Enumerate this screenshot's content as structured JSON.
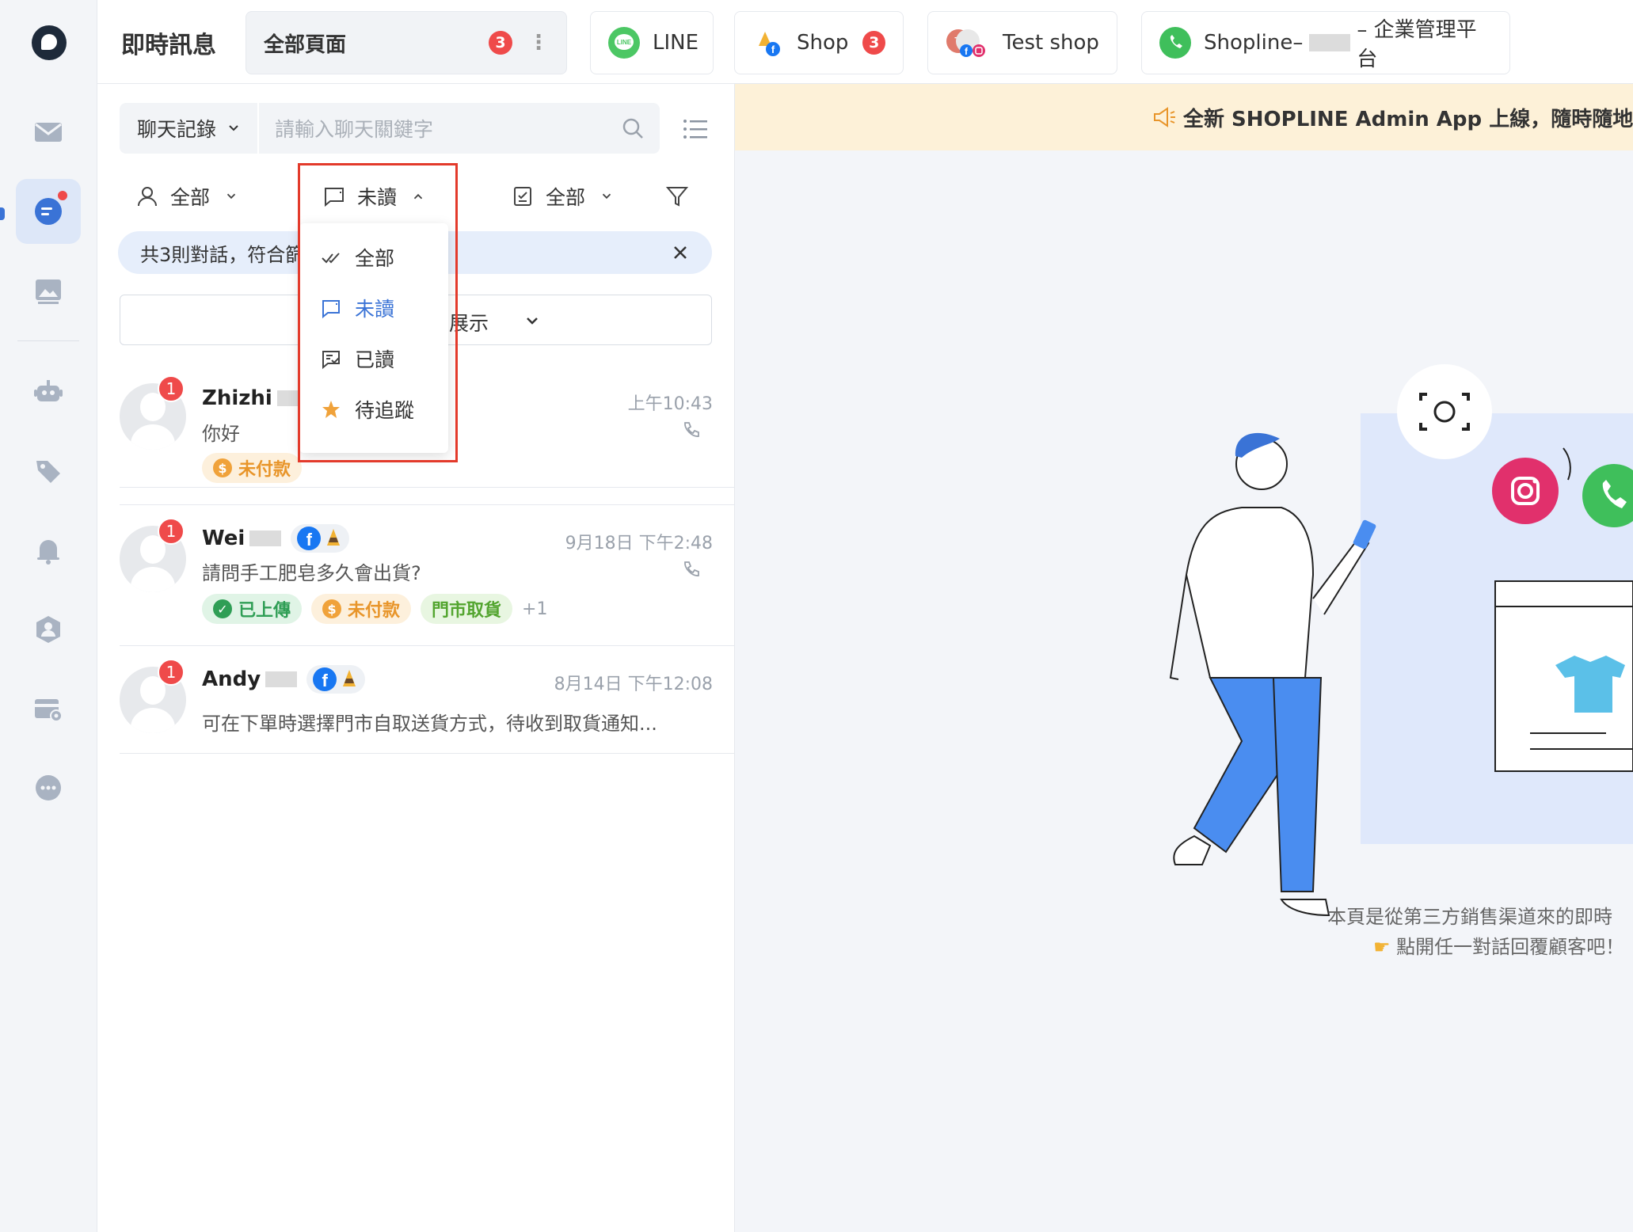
{
  "header": {
    "app_title": "即時訊息",
    "tabs": [
      {
        "label": "全部頁面",
        "badge": "3"
      },
      {
        "label": "LINE"
      },
      {
        "label": "Shop",
        "badge": "3"
      },
      {
        "label": "Test shop"
      },
      {
        "label_prefix": "Shopline–",
        "label_suffix": "– 企業管理平台"
      }
    ]
  },
  "search": {
    "scope": "聊天記錄",
    "placeholder": "請輸入聊天關鍵字"
  },
  "filters": {
    "assignee": "全部",
    "read_state": "未讀",
    "task": "全部"
  },
  "summary": {
    "text": "共3則對話，符合篩"
  },
  "display_box": {
    "text": "展示"
  },
  "read_dropdown": {
    "options": [
      "全部",
      "未讀",
      "已讀",
      "待追蹤"
    ],
    "selected": "未讀"
  },
  "conversations": [
    {
      "name": "Zhizhi",
      "unread": "1",
      "time": "上午10:43",
      "message": "你好",
      "tags": [
        "未付款"
      ]
    },
    {
      "name": "Wei",
      "unread": "1",
      "time": "9月18日 下午2:48",
      "message": "請問手工肥皂多久會出貨?",
      "tags": [
        "已上傳",
        "未付款",
        "門市取貨"
      ],
      "more": "+1"
    },
    {
      "name": "Andy",
      "unread": "1",
      "time": "8月14日 下午12:08",
      "message": "可在下單時選擇門市自取送貨方式，待收到取貨通知..."
    }
  ],
  "banner": {
    "text": "全新 SHOPLINE Admin App 上線，隨時隨地收發訊"
  },
  "empty_state": {
    "line1": "本頁是從第三方銷售渠道來的即時",
    "line2": "點開任一對話回覆顧客吧！"
  },
  "colors": {
    "accent": "#3a73d6",
    "badge_red": "#ef4a4a",
    "highlight_red": "#e33a2b",
    "banner_bg": "#fdf1d8"
  }
}
